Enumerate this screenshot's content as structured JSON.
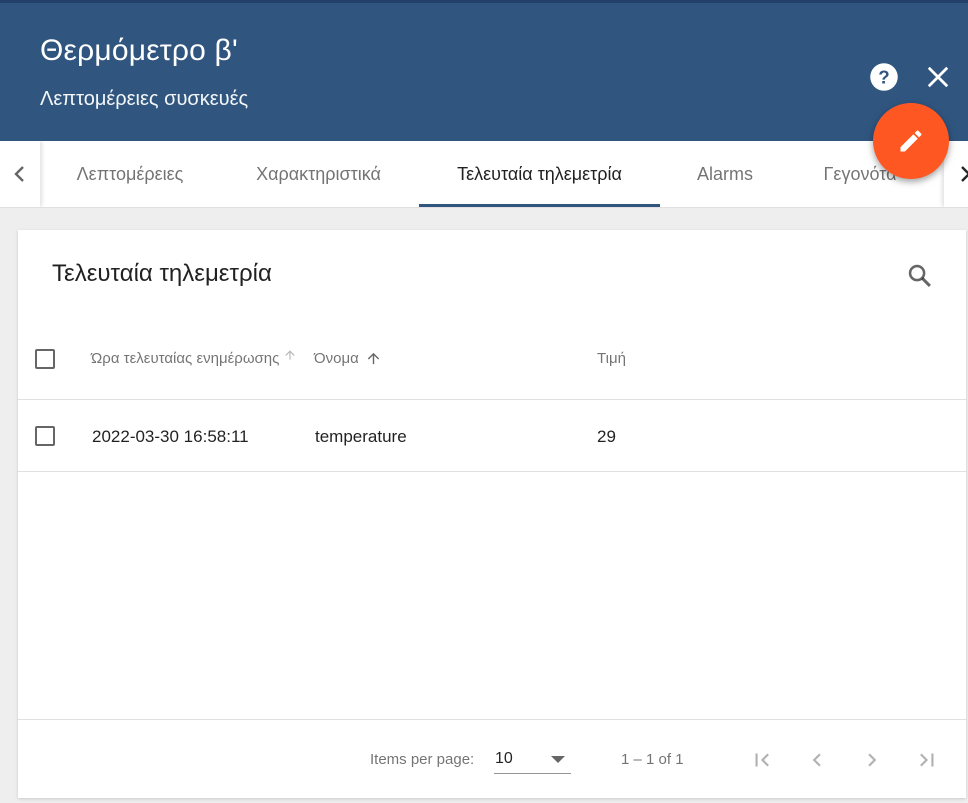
{
  "header": {
    "title": "Θερμόμετρο β'",
    "subtitle": "Λεπτομέρειες συσκευές",
    "background_color": "#305680",
    "icons": {
      "help": "help-circle-icon",
      "close": "close-icon",
      "edit": "pencil-icon"
    },
    "fab_color": "#ff5722"
  },
  "tabs": {
    "items": [
      {
        "label": "Λεπτομέρειες"
      },
      {
        "label": "Χαρακτηριστικά"
      },
      {
        "label": "Τελευταία τηλεμετρία",
        "active": true
      },
      {
        "label": "Alarms"
      },
      {
        "label": "Γεγονότα"
      }
    ],
    "scroll_left_icon": "chevron-left-icon",
    "scroll_right_icon": "chevron-right-icon"
  },
  "card": {
    "title": "Τελευταία τηλεμετρία",
    "search_icon": "search-icon",
    "table": {
      "columns": [
        {
          "label": "Ώρα τελευταίας ενημέρωσης"
        },
        {
          "label": "Όνομα",
          "sorted": "ascending"
        },
        {
          "label": "Τιμή"
        }
      ],
      "rows": [
        {
          "last_update": "2022-03-30 16:58:11",
          "name": "temperature",
          "value": "29"
        }
      ]
    },
    "paginator": {
      "items_per_page_label": "Items per page:",
      "page_size": "10",
      "range_label": "1 – 1 of 1",
      "icons": [
        "first-page-icon",
        "previous-page-icon",
        "next-page-icon",
        "last-page-icon"
      ]
    }
  }
}
